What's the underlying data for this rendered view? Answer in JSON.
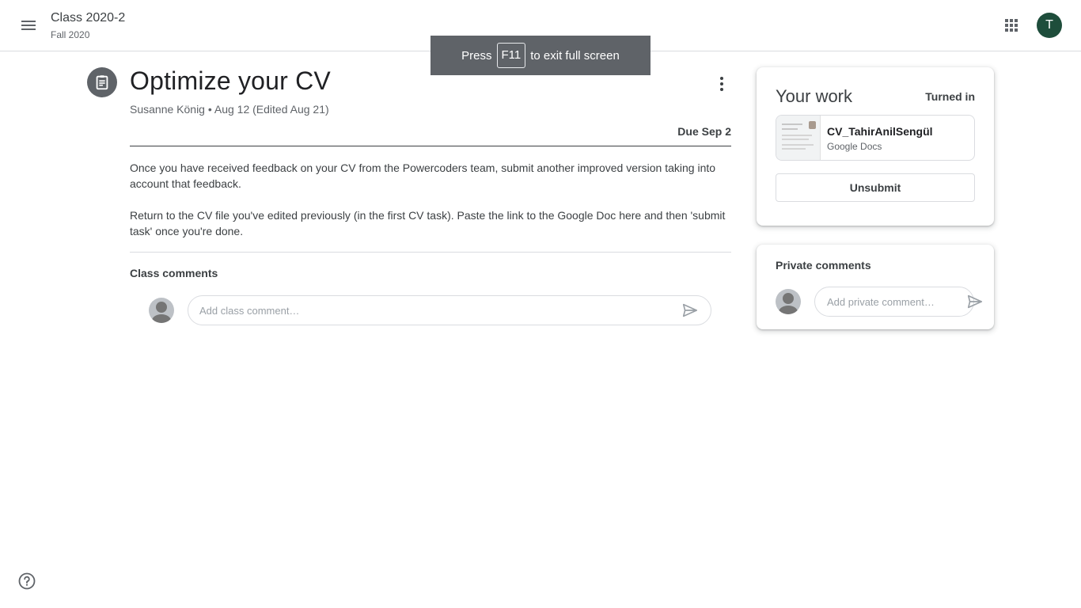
{
  "header": {
    "class_name": "Class 2020-2",
    "class_section": "Fall 2020",
    "menu_icon": "hamburger-menu-icon",
    "apps_icon": "apps-grid-icon",
    "user_initial": "T",
    "user_avatar_color": "#1e4d3b"
  },
  "fullscreen_notice": {
    "prefix": "Press",
    "key": "F11",
    "suffix": "to exit full screen"
  },
  "assignment": {
    "icon": "assignment-icon",
    "title": "Optimize your CV",
    "meta": "Susanne König • Aug 12 (Edited Aug 21)",
    "due": "Due Sep 2",
    "description": [
      "Once you have received feedback on your CV from the Powercoders team, submit another improved version taking into account that feedback.",
      "Return to the CV file you've edited previously (in the first CV task). Paste the link to the Google Doc here and then 'submit task' once you're done."
    ]
  },
  "class_comments": {
    "label": "Class comments",
    "placeholder": "Add class comment…"
  },
  "your_work": {
    "title": "Your work",
    "status": "Turned in",
    "attachment": {
      "name": "CV_TahirAnilSengül",
      "type": "Google Docs"
    },
    "unsubmit_label": "Unsubmit"
  },
  "private_comments": {
    "label": "Private comments",
    "placeholder": "Add private comment…"
  },
  "help_icon": "help-icon"
}
